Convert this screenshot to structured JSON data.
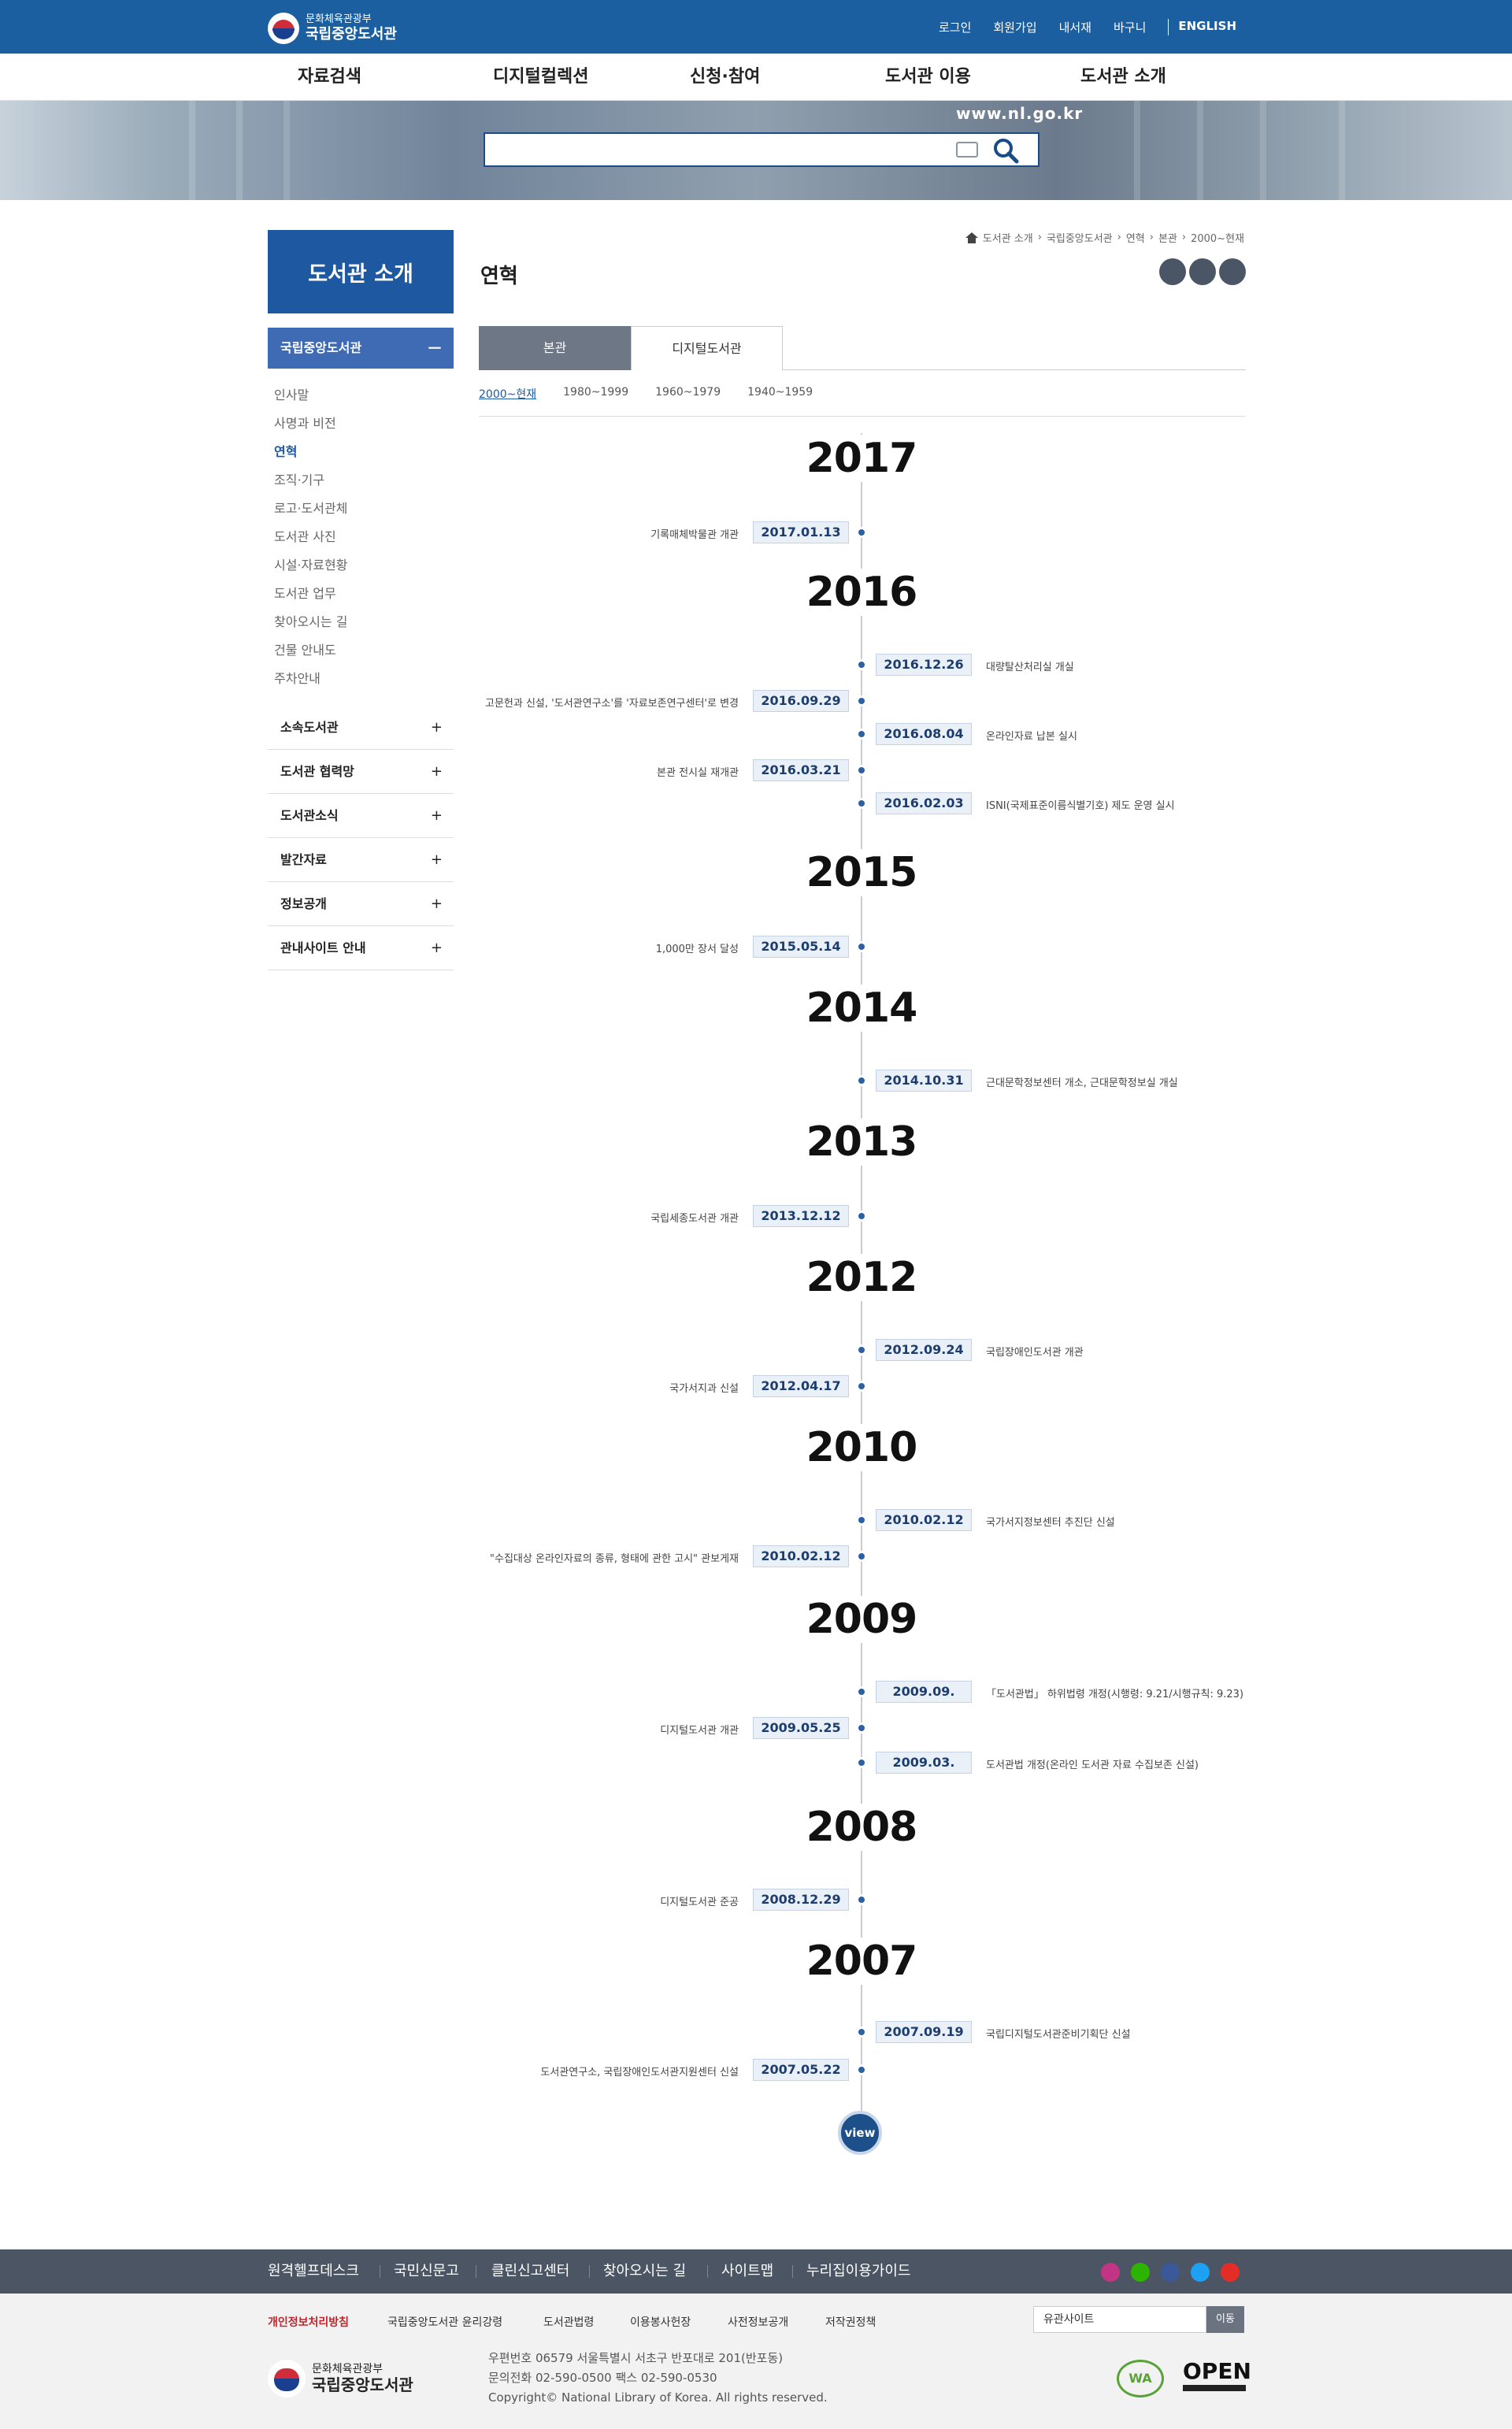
{
  "header": {
    "ministry": "문화체육관광부",
    "library": "국립중앙도서관",
    "top_links": [
      "로그인",
      "회원가입",
      "내서재",
      "바구니",
      "ENGLISH"
    ],
    "gnb": [
      "자료검색",
      "디지털컬렉션",
      "신청·참여",
      "도서관 이용",
      "도서관 소개"
    ],
    "url_text": "www.nl.go.kr",
    "search_placeholder": ""
  },
  "sidebar": {
    "title": "도서관 소개",
    "active_group": "국립중앙도서관",
    "active_sign": "－",
    "sub_items": [
      "인사말",
      "사명과 비전",
      "연혁",
      "조직·기구",
      "로고·도서관체",
      "도서관 사진",
      "시설·자료현황",
      "도서관 업무",
      "찾아오시는 길",
      "건물 안내도",
      "주차안내"
    ],
    "selected_sub": "연혁",
    "groups": [
      "소속도서관",
      "도서관 협력망",
      "도서관소식",
      "발간자료",
      "정보공개",
      "관내사이트 안내"
    ],
    "plus_sign": "+"
  },
  "main": {
    "title": "연혁",
    "breadcrumb": [
      "도서관 소개",
      "국립중앙도서관",
      "연혁",
      "본관",
      "2000~현재"
    ],
    "tabs": [
      "본관",
      "디지털도서관"
    ],
    "periods": [
      "2000~현재",
      "1980~1999",
      "1960~1979",
      "1940~1959"
    ],
    "view_label": "view"
  },
  "timeline": {
    "years": [
      "2017",
      "2016",
      "2015",
      "2014",
      "2013",
      "2012",
      "2010",
      "2009",
      "2008",
      "2007"
    ],
    "events": [
      {
        "date": "2017.01.13",
        "text": "기록매체박물관 개관",
        "side": "l"
      },
      {
        "date": "2016.12.26",
        "text": "대량탈산처리실 개실",
        "side": "r"
      },
      {
        "date": "2016.09.29",
        "text": "고문헌과 신설, '도서관연구소'를 '자료보존연구센터'로 변경",
        "side": "l"
      },
      {
        "date": "2016.08.04",
        "text": "온라인자료 납본 실시",
        "side": "r"
      },
      {
        "date": "2016.03.21",
        "text": "본관 전시실 재개관",
        "side": "l"
      },
      {
        "date": "2016.02.03",
        "text": "ISNI(국제표준이름식별기호) 제도 운영 실시",
        "side": "r"
      },
      {
        "date": "2015.05.14",
        "text": "1,000만 장서 달성",
        "side": "l"
      },
      {
        "date": "2014.10.31",
        "text": "근대문학정보센터 개소, 근대문학정보실 개실",
        "side": "r"
      },
      {
        "date": "2013.12.12",
        "text": "국립세종도서관 개관",
        "side": "l"
      },
      {
        "date": "2012.09.24",
        "text": "국립장애인도서관 개관",
        "side": "r"
      },
      {
        "date": "2012.04.17",
        "text": "국가서지과 신설",
        "side": "l"
      },
      {
        "date": "2010.02.12",
        "text": "국가서지정보센터 추진단 신설",
        "side": "r"
      },
      {
        "date": "2010.02.12",
        "text": "\"수집대상 온라인자료의 종류, 형태에 관한 고시\" 관보게재",
        "side": "l"
      },
      {
        "date": "2009.09.",
        "text": "「도서관법」 하위법령 개정(시행령: 9.21/시행규칙: 9.23)",
        "side": "r"
      },
      {
        "date": "2009.05.25",
        "text": "디지털도서관 개관",
        "side": "l"
      },
      {
        "date": "2009.03.",
        "text": "도서관법 개정(온라인 도서관 자료 수집보존 신설)",
        "side": "r"
      },
      {
        "date": "2008.12.29",
        "text": "디지털도서관 준공",
        "side": "l"
      },
      {
        "date": "2007.09.19",
        "text": "국립디지털도서관준비기획단 신설",
        "side": "r"
      },
      {
        "date": "2007.05.22",
        "text": "도서관연구소, 국립장애인도서관지원센터 신설",
        "side": "l"
      }
    ]
  },
  "footer": {
    "links1": [
      "원격헬프데스크",
      "국민신문고",
      "클린신고센터",
      "찾아오시는 길",
      "사이트맵",
      "누리집이용가이드"
    ],
    "links2": [
      "개인정보처리방침",
      "국립중앙도서관 윤리강령",
      "도서관법령",
      "이용봉사헌장",
      "사전정보공개",
      "저작권정책"
    ],
    "site_select": "유관사이트",
    "go_button": "이동",
    "address": "우편번호 06579 서울특별시 서초구 반포대로 201(반포동)",
    "phone": "문의전화 02-590-0500 팩스 02-590-0530",
    "copyright": "Copyright© National Library of Korea. All rights reserved.",
    "wa_badge": "WA",
    "open_badge": "OPEN",
    "sns_colors": [
      "#c13584",
      "#2db400",
      "#3b5998",
      "#1da1f2",
      "#e52d27"
    ]
  }
}
